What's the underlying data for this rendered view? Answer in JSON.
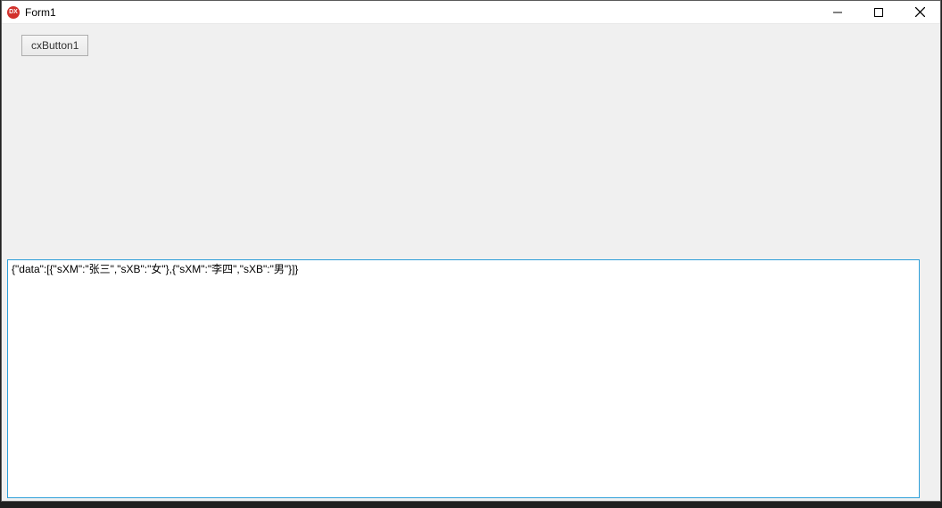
{
  "window": {
    "title": "Form1",
    "app_icon_text": "DX"
  },
  "controls": {
    "button1_label": "cxButton1"
  },
  "memo": {
    "content": "{\"data\":[{\"sXM\":\"张三\",\"sXB\":\"女\"},{\"sXM\":\"李四\",\"sXB\":\"男\"}]}"
  }
}
